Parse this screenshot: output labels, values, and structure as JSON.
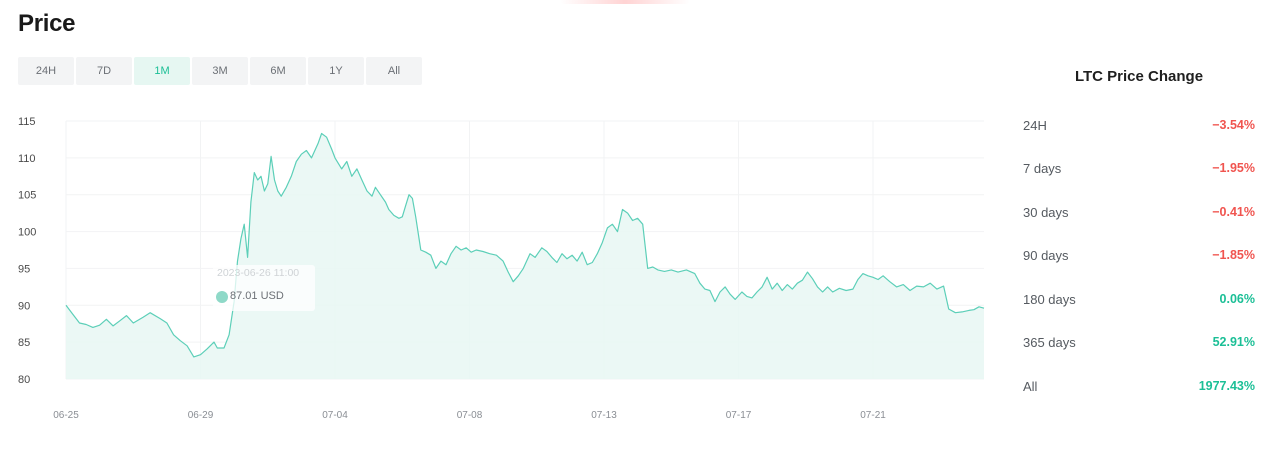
{
  "page": {
    "title": "Price"
  },
  "range_tabs": [
    {
      "label": "24H",
      "active": false
    },
    {
      "label": "7D",
      "active": false
    },
    {
      "label": "1M",
      "active": true
    },
    {
      "label": "3M",
      "active": false
    },
    {
      "label": "6M",
      "active": false
    },
    {
      "label": "1Y",
      "active": false
    },
    {
      "label": "All",
      "active": false
    }
  ],
  "tooltip": {
    "time": "2023-06-26 11:00",
    "value": "87.01 USD"
  },
  "price_change": {
    "title": "LTC Price Change",
    "rows": [
      {
        "period": "24H",
        "value": "−3.54%",
        "direction": "neg"
      },
      {
        "period": "7 days",
        "value": "−1.95%",
        "direction": "neg"
      },
      {
        "period": "30 days",
        "value": "−0.41%",
        "direction": "neg"
      },
      {
        "period": "90 days",
        "value": "−1.85%",
        "direction": "neg"
      },
      {
        "period": "180 days",
        "value": "0.06%",
        "direction": "pos"
      },
      {
        "period": "365 days",
        "value": "52.91%",
        "direction": "pos"
      },
      {
        "period": "All",
        "value": "1977.43%",
        "direction": "pos"
      }
    ]
  },
  "colors": {
    "accent": "#1bbf96",
    "negative": "#f0544f",
    "line": "#5ccfb8",
    "area": "#e8f7f3"
  },
  "chart_data": {
    "type": "area",
    "ylim": [
      80,
      115
    ],
    "yticks": [
      115,
      110,
      105,
      100,
      95,
      90,
      85,
      80
    ],
    "xticks": [
      "06-25",
      "06-29",
      "07-04",
      "07-08",
      "07-13",
      "07-17",
      "07-21"
    ],
    "x_index_range": [
      0,
      30
    ],
    "xtick_index": [
      0,
      4,
      8,
      12,
      16,
      20,
      24
    ],
    "grid": true,
    "series": [
      {
        "values": [
          [
            0,
            90.0
          ],
          [
            0.2,
            88.8
          ],
          [
            0.4,
            87.6
          ],
          [
            0.6,
            87.4
          ],
          [
            0.8,
            87.0
          ],
          [
            1.0,
            87.3
          ],
          [
            1.2,
            88.1
          ],
          [
            1.4,
            87.2
          ],
          [
            1.6,
            87.9
          ],
          [
            1.8,
            88.6
          ],
          [
            2.0,
            87.6
          ],
          [
            2.3,
            88.4
          ],
          [
            2.5,
            89.0
          ],
          [
            2.8,
            88.2
          ],
          [
            3.0,
            87.6
          ],
          [
            3.2,
            86.0
          ],
          [
            3.4,
            85.2
          ],
          [
            3.6,
            84.5
          ],
          [
            3.8,
            83.0
          ],
          [
            4.0,
            83.3
          ],
          [
            4.2,
            84.1
          ],
          [
            4.4,
            85.0
          ],
          [
            4.5,
            84.2
          ],
          [
            4.7,
            84.2
          ],
          [
            4.85,
            86.0
          ],
          [
            5.0,
            90.5
          ],
          [
            5.1,
            96.0
          ],
          [
            5.2,
            99.0
          ],
          [
            5.3,
            101.0
          ],
          [
            5.4,
            96.5
          ],
          [
            5.5,
            104.0
          ],
          [
            5.6,
            108.0
          ],
          [
            5.7,
            107.0
          ],
          [
            5.8,
            107.5
          ],
          [
            5.9,
            105.5
          ],
          [
            6.0,
            106.5
          ],
          [
            6.1,
            110.2
          ],
          [
            6.2,
            107.0
          ],
          [
            6.3,
            105.5
          ],
          [
            6.4,
            104.8
          ],
          [
            6.55,
            106.0
          ],
          [
            6.7,
            107.5
          ],
          [
            6.85,
            109.5
          ],
          [
            7.0,
            110.5
          ],
          [
            7.15,
            111.0
          ],
          [
            7.3,
            110.0
          ],
          [
            7.5,
            112.0
          ],
          [
            7.6,
            113.3
          ],
          [
            7.75,
            112.8
          ],
          [
            7.9,
            111.2
          ],
          [
            8.0,
            110.0
          ],
          [
            8.2,
            108.5
          ],
          [
            8.35,
            109.5
          ],
          [
            8.5,
            107.5
          ],
          [
            8.65,
            108.5
          ],
          [
            8.8,
            107.0
          ],
          [
            8.95,
            105.5
          ],
          [
            9.1,
            104.8
          ],
          [
            9.2,
            106.0
          ],
          [
            9.35,
            105.0
          ],
          [
            9.5,
            104.0
          ],
          [
            9.6,
            103.0
          ],
          [
            9.75,
            102.2
          ],
          [
            9.9,
            101.8
          ],
          [
            10.0,
            102.0
          ],
          [
            10.1,
            103.5
          ],
          [
            10.2,
            105.0
          ],
          [
            10.3,
            104.5
          ],
          [
            10.4,
            102.0
          ],
          [
            10.55,
            97.5
          ],
          [
            10.7,
            97.2
          ],
          [
            10.85,
            96.8
          ],
          [
            11.0,
            95.0
          ],
          [
            11.15,
            96.0
          ],
          [
            11.3,
            95.5
          ],
          [
            11.45,
            97.0
          ],
          [
            11.6,
            98.0
          ],
          [
            11.75,
            97.5
          ],
          [
            11.9,
            97.8
          ],
          [
            12.05,
            97.2
          ],
          [
            12.2,
            97.5
          ],
          [
            12.4,
            97.3
          ],
          [
            12.6,
            97.0
          ],
          [
            12.8,
            96.8
          ],
          [
            13.0,
            96.0
          ],
          [
            13.15,
            94.5
          ],
          [
            13.3,
            93.2
          ],
          [
            13.45,
            94.0
          ],
          [
            13.6,
            95.0
          ],
          [
            13.8,
            97.0
          ],
          [
            13.95,
            96.5
          ],
          [
            14.15,
            97.8
          ],
          [
            14.3,
            97.3
          ],
          [
            14.45,
            96.5
          ],
          [
            14.6,
            95.8
          ],
          [
            14.75,
            97.0
          ],
          [
            14.9,
            96.3
          ],
          [
            15.05,
            96.8
          ],
          [
            15.2,
            96.0
          ],
          [
            15.35,
            97.2
          ],
          [
            15.5,
            95.5
          ],
          [
            15.65,
            95.8
          ],
          [
            15.8,
            97.0
          ],
          [
            15.95,
            98.5
          ],
          [
            16.1,
            100.5
          ],
          [
            16.25,
            101.0
          ],
          [
            16.4,
            100.0
          ],
          [
            16.55,
            103.0
          ],
          [
            16.7,
            102.5
          ],
          [
            16.85,
            101.5
          ],
          [
            17.0,
            101.8
          ],
          [
            17.15,
            101.0
          ],
          [
            17.3,
            95.0
          ],
          [
            17.45,
            95.2
          ],
          [
            17.6,
            94.8
          ],
          [
            17.8,
            94.6
          ],
          [
            18.0,
            94.8
          ],
          [
            18.2,
            94.5
          ],
          [
            18.45,
            94.8
          ],
          [
            18.7,
            94.3
          ],
          [
            18.85,
            93.0
          ],
          [
            19.0,
            92.2
          ],
          [
            19.15,
            92.0
          ],
          [
            19.3,
            90.5
          ],
          [
            19.45,
            91.8
          ],
          [
            19.6,
            92.5
          ],
          [
            19.75,
            91.5
          ],
          [
            19.9,
            90.8
          ],
          [
            20.1,
            91.8
          ],
          [
            20.25,
            91.2
          ],
          [
            20.4,
            91.0
          ],
          [
            20.55,
            91.8
          ],
          [
            20.7,
            92.5
          ],
          [
            20.85,
            93.8
          ],
          [
            21.0,
            92.2
          ],
          [
            21.15,
            93.0
          ],
          [
            21.3,
            92.0
          ],
          [
            21.45,
            92.8
          ],
          [
            21.6,
            92.2
          ],
          [
            21.75,
            93.0
          ],
          [
            21.9,
            93.4
          ],
          [
            22.05,
            94.5
          ],
          [
            22.2,
            93.6
          ],
          [
            22.35,
            92.5
          ],
          [
            22.5,
            91.8
          ],
          [
            22.65,
            92.5
          ],
          [
            22.8,
            91.8
          ],
          [
            23.0,
            92.3
          ],
          [
            23.2,
            92.0
          ],
          [
            23.4,
            92.2
          ],
          [
            23.55,
            93.5
          ],
          [
            23.7,
            94.3
          ],
          [
            23.85,
            94.0
          ],
          [
            24.0,
            93.8
          ],
          [
            24.15,
            93.5
          ],
          [
            24.3,
            94.0
          ],
          [
            24.5,
            93.2
          ],
          [
            24.7,
            92.5
          ],
          [
            24.9,
            92.8
          ],
          [
            25.1,
            92.0
          ],
          [
            25.3,
            92.6
          ],
          [
            25.5,
            92.5
          ],
          [
            25.7,
            93.0
          ],
          [
            25.9,
            92.2
          ],
          [
            26.1,
            92.6
          ],
          [
            26.25,
            89.5
          ],
          [
            26.45,
            89.0
          ],
          [
            26.65,
            89.1
          ],
          [
            26.85,
            89.3
          ],
          [
            27.0,
            89.4
          ],
          [
            27.15,
            89.8
          ],
          [
            27.3,
            89.6
          ]
        ]
      }
    ],
    "highlight_point": {
      "x": 4.6,
      "y": 87.01
    }
  }
}
